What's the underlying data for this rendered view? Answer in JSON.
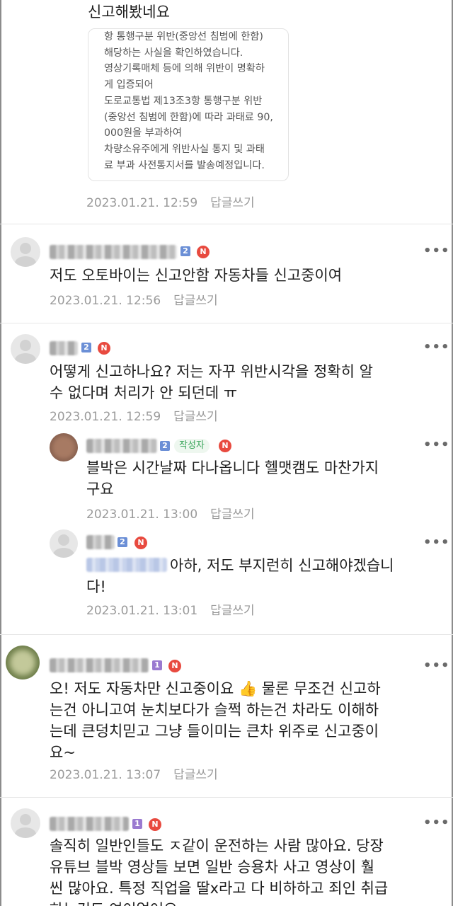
{
  "top_comment": {
    "text": "신고해봤네요",
    "quote_lines": "항 통행구분 위반(중앙선 침범에 한함)\n해당하는 사실을 확인하였습니다.\n영상기록매체 등에 의해 위반이 명확하\n게 입증되어\n도로교통법 제13조3항 통행구분 위반\n(중앙선 침범에 한함)에 따라 과태료 90,\n000원을 부과하여\n차량소유주에게 위반사실 통지 및 과태\n료 부과 사전통지서를 발송예정입니다.",
    "timestamp": "2023.01.21. 12:59",
    "reply_label": "답글쓰기"
  },
  "comments": [
    {
      "level": "2",
      "n_badge": "N",
      "text": "저도 오토바이는 신고안함 자동차들 신고중이여",
      "timestamp": "2023.01.21. 12:56",
      "reply_label": "답글쓰기"
    },
    {
      "level": "2",
      "n_badge": "N",
      "text": "어떻게 신고하나요? 저는 자꾸 위반시각을 정확히 알\n수 없다며 처리가 안 되던데 ㅠ",
      "timestamp": "2023.01.21. 12:59",
      "reply_label": "답글쓰기",
      "replies": [
        {
          "level": "2",
          "author_badge": "작성자",
          "n_badge": "N",
          "text": "블박은 시간날짜 다나옵니다 헬맷캠도 마찬가지\n구요",
          "timestamp": "2023.01.21. 13:00",
          "reply_label": "답글쓰기"
        },
        {
          "level": "2",
          "n_badge": "N",
          "text_first": "아하, 저도 부지런히 신고해야겠습니",
          "text_second": "다!",
          "timestamp": "2023.01.21. 13:01",
          "reply_label": "답글쓰기"
        }
      ]
    },
    {
      "level": "1",
      "n_badge": "N",
      "text": "오! 저도 자동차만 신고중이요 👍 물론 무조건 신고하\n는건 아니고여 눈치보다가 슬쩍 하는건 차라도 이해하\n는데 큰덩치믿고 그냥 들이미는 큰차 위주로 신고중이\n요~",
      "timestamp": "2023.01.21. 13:07",
      "reply_label": "답글쓰기"
    },
    {
      "level": "1",
      "n_badge": "N",
      "text": "솔직히 일반인들도 ㅈ같이 운전하는 사람 많아요. 당장\n유튜브 블박 영상들 보면 일반 승용차 사고 영상이 훨\n씬 많아요. 특정 직업을 딸x라고 다 비하하고 죄인 취급\n하는것도 여이없어요"
    }
  ],
  "more_glyph": "•••",
  "colors": {
    "n_badge": "#e84a3f",
    "level_blue": "#6b8fd6",
    "level_purple": "#9a7ad0",
    "author_badge_text": "#3aa55a",
    "meta_gray": "#9b9b9b"
  }
}
